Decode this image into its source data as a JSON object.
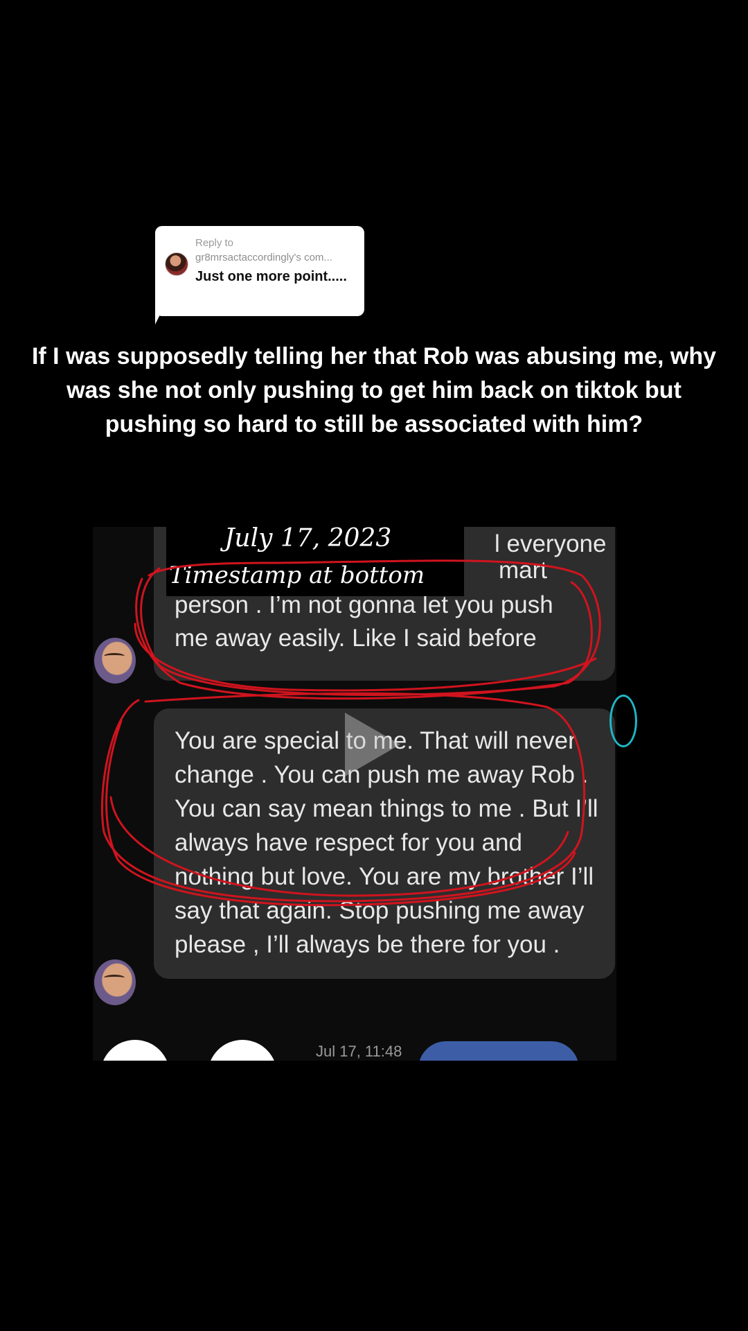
{
  "reply": {
    "label": "Reply to",
    "username": "gr8mrsactaccordingly's com...",
    "comment": "Just one more point....."
  },
  "caption": "If I was supposedly telling her that Rob was abusing me, why was she not only pushing to get him back on tiktok but pushing so hard to still be associated with him?",
  "overlay": {
    "date": "July 17, 2023",
    "note": "Timestamp at bottom"
  },
  "messages": {
    "top_fragment_1": "l everyone",
    "top_fragment_2": "mart",
    "top_line_3": "person . I’m not gonna let you push",
    "top_line_4": "me away easily. Like I said before",
    "main_text": "You are special to me. That will never change . You can push me away Rob . You can say mean things to me . But I’ll always have respect for you and nothing but love. You are my brother I’ll say that again. Stop pushing me away please , I’ll always be there for you .",
    "timestamp": "Jul 17, 11:48"
  },
  "colors": {
    "bubble": "#2d2d2d",
    "scribble": "#d0141e",
    "pill": "#3d5ea6"
  }
}
